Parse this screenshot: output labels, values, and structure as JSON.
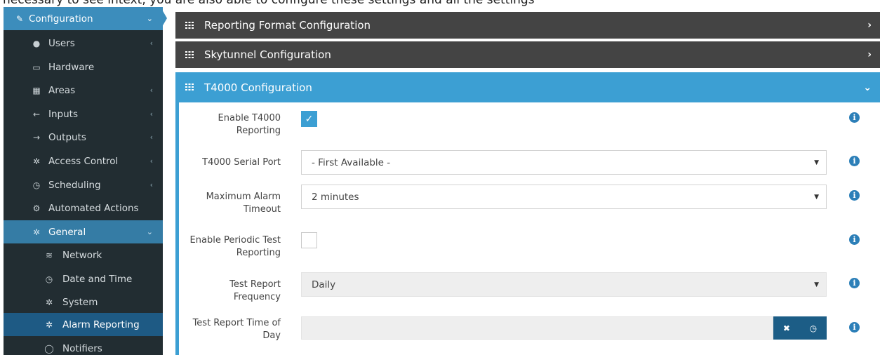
{
  "top_strip_text": "necessary to see intext, you are also able to configure these settings and all the settings",
  "sidebar": {
    "items": [
      {
        "label": "Configuration",
        "icon": "edit-icon"
      },
      {
        "label": "Users",
        "icon": "user-icon"
      },
      {
        "label": "Hardware",
        "icon": "hard-drive-icon"
      },
      {
        "label": "Areas",
        "icon": "grid-icon"
      },
      {
        "label": "Inputs",
        "icon": "arrow-left-icon"
      },
      {
        "label": "Outputs",
        "icon": "arrow-right-icon"
      },
      {
        "label": "Access Control",
        "icon": "gear-icon"
      },
      {
        "label": "Scheduling",
        "icon": "clock-icon"
      },
      {
        "label": "Automated Actions",
        "icon": "gears-icon"
      },
      {
        "label": "General",
        "icon": "gear-icon"
      },
      {
        "label": "Network",
        "icon": "wifi-icon"
      },
      {
        "label": "Date and Time",
        "icon": "clock-icon"
      },
      {
        "label": "System",
        "icon": "gear-icon"
      },
      {
        "label": "Alarm Reporting",
        "icon": "gear-icon"
      },
      {
        "label": "Notifiers",
        "icon": "comment-icon"
      }
    ]
  },
  "panels": {
    "reporting_format": "Reporting Format Configuration",
    "skytunnel": "Skytunnel Configuration",
    "t4000": "T4000 Configuration"
  },
  "form": {
    "enable_t4000_label": "Enable T4000 Reporting",
    "enable_t4000_checked": true,
    "serial_port_label": "T4000 Serial Port",
    "serial_port_value": "- First Available -",
    "max_alarm_label": "Maximum Alarm Timeout",
    "max_alarm_value": "2 minutes",
    "periodic_test_label": "Enable Periodic Test Reporting",
    "periodic_test_checked": false,
    "test_freq_label": "Test Report Frequency",
    "test_freq_value": "Daily",
    "test_time_label": "Test Report Time of Day",
    "test_time_value": ""
  },
  "colors": {
    "sidebar_bg": "#222d32",
    "accent_blue": "#3c8dbc",
    "panel_open": "#3c9fd3",
    "panel_closed": "#444444",
    "active_item": "#1e5a84"
  }
}
